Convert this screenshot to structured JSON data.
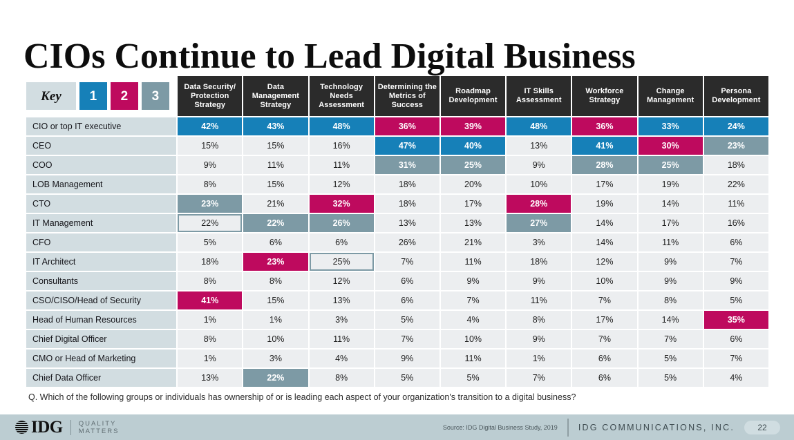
{
  "title": "CIOs Continue to Lead Digital Business",
  "key": {
    "label": "Key",
    "rank1": "1",
    "rank2": "2",
    "rank3": "3"
  },
  "colors": {
    "rank1_blue": "#1680b8",
    "rank2_magenta": "#be0a5e",
    "rank3_gray": "#7d9aa5",
    "header_dark": "#2b2b2b",
    "row_label_bg": "#d2dde1",
    "cell_bg": "#eceef0",
    "footer_bg": "#bccdd2"
  },
  "chart_data": {
    "type": "heatmap",
    "title": "CIOs Continue to Lead Digital Business",
    "xlabel": "",
    "ylabel": "",
    "legend": [
      "1",
      "2",
      "3"
    ],
    "legend_position": "top-left",
    "columns": [
      "Data Security/ Protection Strategy",
      "Data Management Strategy",
      "Technology Needs Assessment",
      "Determining the Metrics of Success",
      "Roadmap Development",
      "IT Skills Assessment",
      "Workforce Strategy",
      "Change Management",
      "Persona Development"
    ],
    "categories": [
      "CIO or top IT executive",
      "CEO",
      "COO",
      "LOB Management",
      "CTO",
      "IT Management",
      "CFO",
      "IT Architect",
      "Consultants",
      "CSO/CISO/Head of Security",
      "Head of Human Resources",
      "Chief Digital Officer",
      "CMO or Head of Marketing",
      "Chief Data Officer"
    ],
    "values": [
      [
        42,
        43,
        48,
        36,
        39,
        48,
        36,
        33,
        24
      ],
      [
        15,
        15,
        16,
        47,
        40,
        13,
        41,
        30,
        23
      ],
      [
        9,
        11,
        11,
        31,
        25,
        9,
        28,
        25,
        18
      ],
      [
        8,
        15,
        12,
        18,
        20,
        10,
        17,
        19,
        22
      ],
      [
        23,
        21,
        32,
        18,
        17,
        28,
        19,
        14,
        11
      ],
      [
        22,
        22,
        26,
        13,
        13,
        27,
        14,
        17,
        16
      ],
      [
        5,
        6,
        6,
        26,
        21,
        3,
        14,
        11,
        6
      ],
      [
        18,
        23,
        25,
        7,
        11,
        18,
        12,
        9,
        7
      ],
      [
        8,
        8,
        12,
        6,
        9,
        9,
        10,
        9,
        9
      ],
      [
        41,
        15,
        13,
        6,
        7,
        11,
        7,
        8,
        5
      ],
      [
        1,
        1,
        3,
        5,
        4,
        8,
        17,
        14,
        35
      ],
      [
        8,
        10,
        11,
        7,
        10,
        9,
        7,
        7,
        6
      ],
      [
        1,
        3,
        4,
        9,
        11,
        1,
        6,
        5,
        7
      ],
      [
        13,
        22,
        8,
        5,
        5,
        7,
        6,
        5,
        4
      ]
    ],
    "ranks": [
      [
        "r1",
        "r1",
        "r1",
        "r2",
        "r2",
        "r1",
        "r2",
        "r1",
        "r1"
      ],
      [
        "",
        "",
        "",
        "r1",
        "r1",
        "",
        "r1",
        "r2",
        "r3"
      ],
      [
        "",
        "",
        "",
        "r3",
        "r3",
        "",
        "r3",
        "r3",
        ""
      ],
      [
        "",
        "",
        "",
        "",
        "",
        "",
        "",
        "",
        ""
      ],
      [
        "r3",
        "",
        "r2",
        "",
        "",
        "r2",
        "",
        "",
        ""
      ],
      [
        "outline",
        "r3",
        "r3",
        "",
        "",
        "r3",
        "",
        "",
        ""
      ],
      [
        "",
        "",
        "",
        "",
        "",
        "",
        "",
        "",
        ""
      ],
      [
        "",
        "r2",
        "outline",
        "",
        "",
        "",
        "",
        "",
        ""
      ],
      [
        "",
        "",
        "",
        "",
        "",
        "",
        "",
        "",
        ""
      ],
      [
        "r2",
        "",
        "",
        "",
        "",
        "",
        "",
        "",
        ""
      ],
      [
        "",
        "",
        "",
        "",
        "",
        "",
        "",
        "",
        "r2"
      ],
      [
        "",
        "",
        "",
        "",
        "",
        "",
        "",
        "",
        ""
      ],
      [
        "",
        "",
        "",
        "",
        "",
        "",
        "",
        "",
        ""
      ],
      [
        "",
        "r3",
        "",
        "",
        "",
        "",
        "",
        "",
        ""
      ]
    ],
    "value_suffix": "%"
  },
  "question": "Q. Which of the following groups or individuals has ownership of or is leading each aspect of your organization's transition to a digital business?",
  "footer": {
    "logo_text": "IDG",
    "tagline_line1": "QUALITY",
    "tagline_line2": "MATTERS",
    "source": "Source: IDG Digital Business Study, 2019",
    "company": "IDG COMMUNICATIONS, INC.",
    "page_number": "22"
  }
}
